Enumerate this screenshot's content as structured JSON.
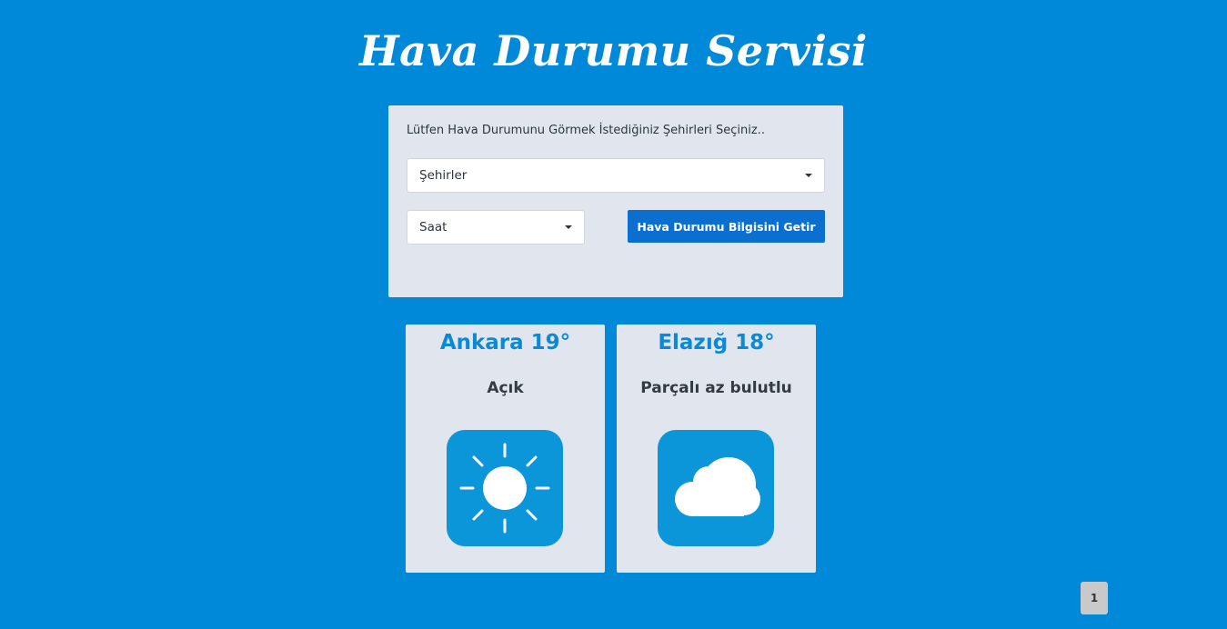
{
  "page": {
    "title": "Hava Durumu Servisi"
  },
  "form": {
    "prompt": "Lütfen Hava Durumunu Görmek İstediğiniz Şehirleri Seçiniz..",
    "city_select_label": "Şehirler",
    "hour_select_label": "Saat",
    "submit_label": "Hava Durumu Bilgisini Getir"
  },
  "cards": [
    {
      "heading": "Ankara 19°",
      "description": "Açık",
      "icon": "sun-icon"
    },
    {
      "heading": "Elazığ 18°",
      "description": "Parçalı az bulutlu",
      "icon": "cloud-icon"
    }
  ],
  "pagination": {
    "current_page": "1"
  },
  "colors": {
    "background": "#0089d9",
    "panel": "#e1e6ee",
    "button": "#0b6fcf",
    "heading_accent": "#0a8ad6",
    "icon_tile": "#0a96d8"
  }
}
